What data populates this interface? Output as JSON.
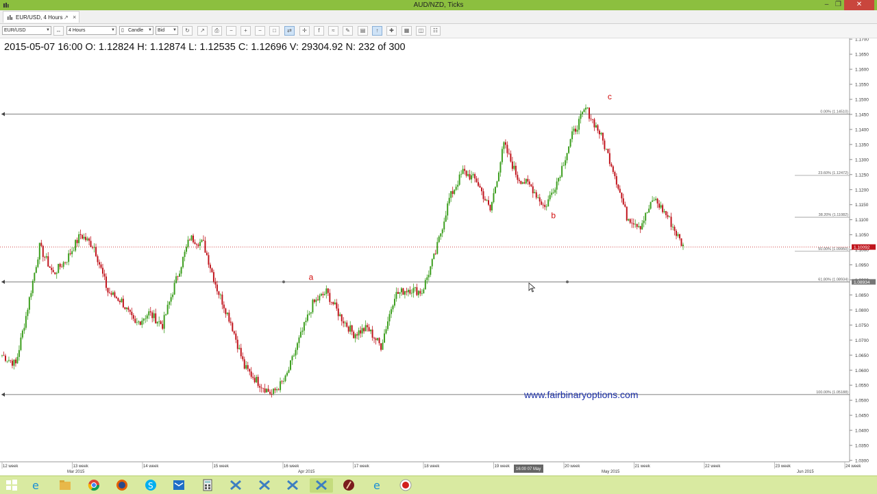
{
  "window": {
    "title": "AUD/NZD, Ticks"
  },
  "tab": {
    "label": "EUR/USD, 4 Hours"
  },
  "toolbar": {
    "instrument": "EUR/USD",
    "period": "4 Hours",
    "chart_type": "Candle",
    "side": "Bid"
  },
  "ohlc": "2015-05-07 16:00 O: 1.12824 H: 1.12874 L: 1.12535 C: 1.12696 V: 29304.92 N: 232 of 300",
  "watermark": "www.fairbinaryoptions.com",
  "colors": {
    "titlebar": "#8cbf3f",
    "bull": "#3c9e1e",
    "bear": "#c0141c",
    "annotation": "#d10a0a",
    "watermark": "#1b2fa8",
    "taskbar": "#d9eaa1"
  },
  "chart_data": {
    "type": "candlestick",
    "instrument": "EUR/USD",
    "ylim": [
      1.03,
      1.18
    ],
    "y_ticks": [
      "1.1750",
      "1.1700",
      "1.1650",
      "1.1600",
      "1.1550",
      "1.1500",
      "1.1450",
      "1.1400",
      "1.1350",
      "1.1300",
      "1.1250",
      "1.1200",
      "1.1150",
      "1.1100",
      "1.1050",
      "1.1000",
      "1.0950",
      "1.0900",
      "1.0850",
      "1.0800",
      "1.0750",
      "1.0700",
      "1.0650",
      "1.0600",
      "1.0550",
      "1.0500",
      "1.0450",
      "1.0400",
      "1.0350",
      "1.0300"
    ],
    "x_week_labels": [
      "12 week",
      "13 week",
      "14 week",
      "15 week",
      "16 week",
      "17 week",
      "18 week",
      "19 week",
      "20 week",
      "21 week",
      "22 week",
      "23 week",
      "24 week"
    ],
    "x_month_labels": [
      "Mar 2015",
      "Apr 2015",
      "May 2015",
      "Jun 2015"
    ],
    "crosshair_time": "16:00 07 May",
    "last_price": "1.10092",
    "hline_price": "1.08934",
    "waypoints": [
      [
        0,
        1.065
      ],
      [
        8,
        1.062
      ],
      [
        14,
        1.078
      ],
      [
        22,
        1.101
      ],
      [
        30,
        1.092
      ],
      [
        38,
        1.097
      ],
      [
        46,
        1.105
      ],
      [
        54,
        1.101
      ],
      [
        62,
        1.086
      ],
      [
        70,
        1.083
      ],
      [
        78,
        1.075
      ],
      [
        86,
        1.079
      ],
      [
        94,
        1.075
      ],
      [
        102,
        1.09
      ],
      [
        110,
        1.104
      ],
      [
        118,
        1.102
      ],
      [
        126,
        1.087
      ],
      [
        134,
        1.076
      ],
      [
        142,
        1.061
      ],
      [
        150,
        1.056
      ],
      [
        158,
        1.052
      ],
      [
        166,
        1.057
      ],
      [
        174,
        1.07
      ],
      [
        182,
        1.082
      ],
      [
        190,
        1.086
      ],
      [
        198,
        1.078
      ],
      [
        206,
        1.072
      ],
      [
        214,
        1.074
      ],
      [
        222,
        1.068
      ],
      [
        230,
        1.085
      ],
      [
        238,
        1.087
      ],
      [
        246,
        1.086
      ],
      [
        254,
        1.099
      ],
      [
        262,
        1.117
      ],
      [
        270,
        1.126
      ],
      [
        278,
        1.123
      ],
      [
        286,
        1.113
      ],
      [
        294,
        1.135
      ],
      [
        302,
        1.124
      ],
      [
        310,
        1.121
      ],
      [
        318,
        1.114
      ],
      [
        326,
        1.124
      ],
      [
        334,
        1.138
      ],
      [
        342,
        1.147
      ],
      [
        350,
        1.139
      ],
      [
        358,
        1.127
      ],
      [
        366,
        1.111
      ],
      [
        374,
        1.108
      ],
      [
        382,
        1.117
      ],
      [
        390,
        1.111
      ],
      [
        399,
        1.101
      ]
    ],
    "annotations": [
      {
        "label": "a",
        "time_index": 181,
        "price": 1.09
      },
      {
        "label": "b",
        "time_index": 323,
        "price": 1.1105
      },
      {
        "label": "c",
        "time_index": 356,
        "price": 1.15
      }
    ],
    "fibonacci": [
      {
        "label": "0.00% (1.14510)",
        "price": 1.1451
      },
      {
        "label": "23.60% (1.12472)",
        "price": 1.12472
      },
      {
        "label": "38.20% (1.11082)",
        "price": 1.11082
      },
      {
        "label": "50.00% (1.09950)",
        "price": 1.0995
      },
      {
        "label": "61.80% (1.08934)",
        "price": 1.08934
      },
      {
        "label": "100.00% (1.05188)",
        "price": 1.05188
      }
    ]
  }
}
